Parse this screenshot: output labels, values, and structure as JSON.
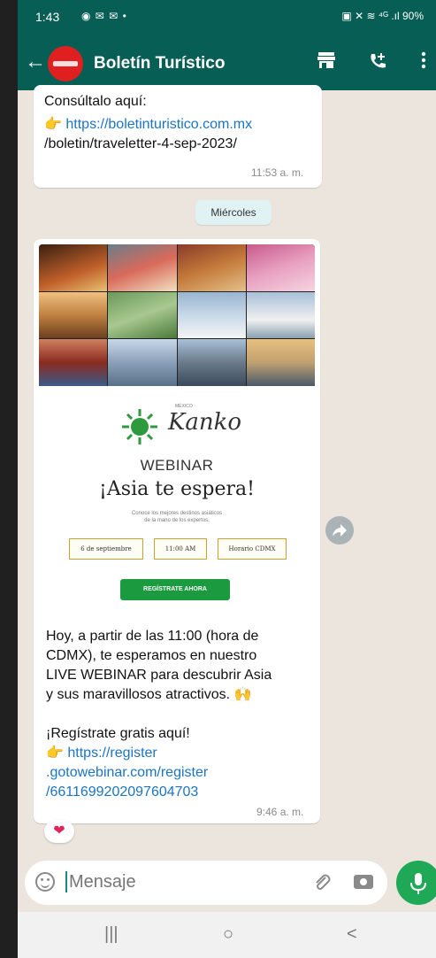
{
  "status_bar": {
    "time": "1:43",
    "left_icons": "◉ ✉ ✉ •",
    "right_icons": "▣ ✕ ≋ ⁴ᴳ .ıl 90%",
    "battery_label": "90%"
  },
  "app_bar": {
    "title": "Boletín Turístico",
    "back_icon": "back-arrow-icon",
    "icons": [
      "store-icon",
      "add-call-icon",
      "more-vert-icon"
    ]
  },
  "messages": {
    "first": {
      "line1": "Consúltalo aquí:",
      "link_line1": "https://boletinturistico.com.mx",
      "link_line2": "/boletin/traveletter-4-sep-2023/",
      "time": "11:53 a. m."
    },
    "date_chip": "Miércoles",
    "second": {
      "image": {
        "brand": "Kanko",
        "brand_small": "MÉXICO",
        "webinar": "WEBINAR",
        "headline": "¡Asia te espera!",
        "sub_line1": "Conoce los mejores destinos asiáticos",
        "sub_line2": "de la mano de los expertos.",
        "pill1": "6 de septiembre",
        "pill2": "11:00 AM",
        "pill3": "Horario CDMX",
        "cta": "REGÍSTRATE AHORA"
      },
      "text_lines": [
        "Hoy, a partir de las 11:00 (hora de",
        "CDMX), te esperamos en nuestro",
        "LIVE WEBINAR para descubrir Asia",
        "y sus maravillosos atractivos. 🙌"
      ],
      "register_line": "¡Regístrate gratis aquí!",
      "link_line1": "https://register",
      "link_line2": ".gotowebinar.com/register",
      "link_line3": "/6611699202097604703",
      "time": "9:46 a. m.",
      "reaction": "❤"
    }
  },
  "composer": {
    "placeholder": "Mensaje"
  },
  "nav": {
    "recents": "|||",
    "home": "○",
    "back": "<"
  },
  "colors": {
    "header": "#075e54",
    "link": "#1b74c5",
    "mic": "#1fa855",
    "chat_bg": "#ece5dd"
  }
}
